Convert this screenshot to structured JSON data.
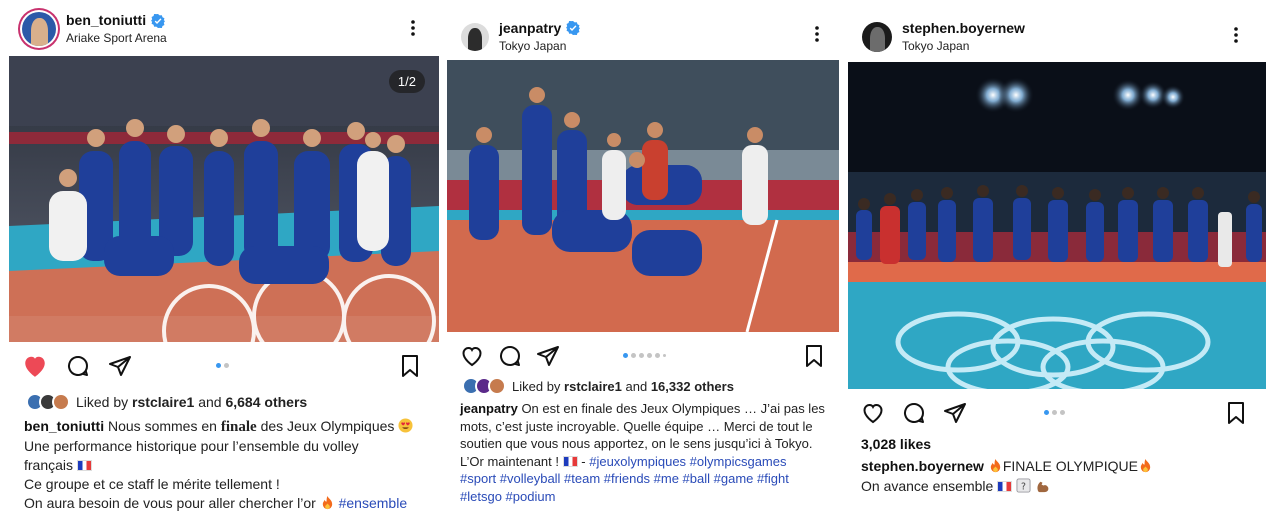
{
  "posts": [
    {
      "username": "ben_toniutti",
      "location": "Ariake Sport Arena",
      "verified": true,
      "media_counter": "1/2",
      "liked_prefix": "Liked by",
      "liked_user": "rstclaire1",
      "liked_and": "and",
      "liked_others": "6,684 others",
      "liked_state": "liked",
      "carousel_dots": 2,
      "caption": {
        "line1_pre": "Nous sommes en",
        "line1_serif": "finale",
        "line1_post": "des Jeux Olympiques",
        "line2": "Une performance historique pour l’ensemble du volley",
        "line3": "français",
        "line4": "Ce groupe et ce staff le mérite tellement !",
        "line5": "On aura besoin de vous pour aller chercher l’or",
        "line5_tag": "#ensemble"
      }
    },
    {
      "username": "jeanpatry",
      "location": "Tokyo Japan",
      "verified": true,
      "liked_prefix": "Liked by",
      "liked_user": "rstclaire1",
      "liked_and": "and",
      "liked_others": "16,332 others",
      "carousel_dots": 6,
      "caption": {
        "line1": "On est en finale des Jeux Olympiques … J’ai pas les",
        "line2": "mots, c’est juste incroyable. Quelle équipe … Merci de tout le",
        "line3": "soutien que vous nous apportez, on le sens jusqu’ici à Tokyo.",
        "line4_pre": "L’Or maintenant !",
        "line4_dash": "-",
        "line4_tags": "#jeuxolympiques #olympicsgames",
        "line5_tags": "#sport #volleyball #team #friends #me #ball #game #fight",
        "line6_tags": "#letsgo #podium"
      }
    },
    {
      "username": "stephen.boyernew",
      "location": "Tokyo Japan",
      "verified": false,
      "likes": "3,028 likes",
      "carousel_dots": 3,
      "caption": {
        "line1": "FINALE OLYMPIQUE",
        "line2": "On avance ensemble"
      }
    }
  ],
  "colors": {
    "heart_liked": "#ed4956",
    "verified": "#3897f0",
    "hashtag": "#2a4bb8",
    "court_blue": "#2fa7c4",
    "court_orange": "#e06a4a",
    "jersey_blue": "#1f3f9a"
  },
  "icons": [
    "heart-icon",
    "comment-icon",
    "share-icon",
    "bookmark-icon",
    "more-icon",
    "verified-icon"
  ]
}
